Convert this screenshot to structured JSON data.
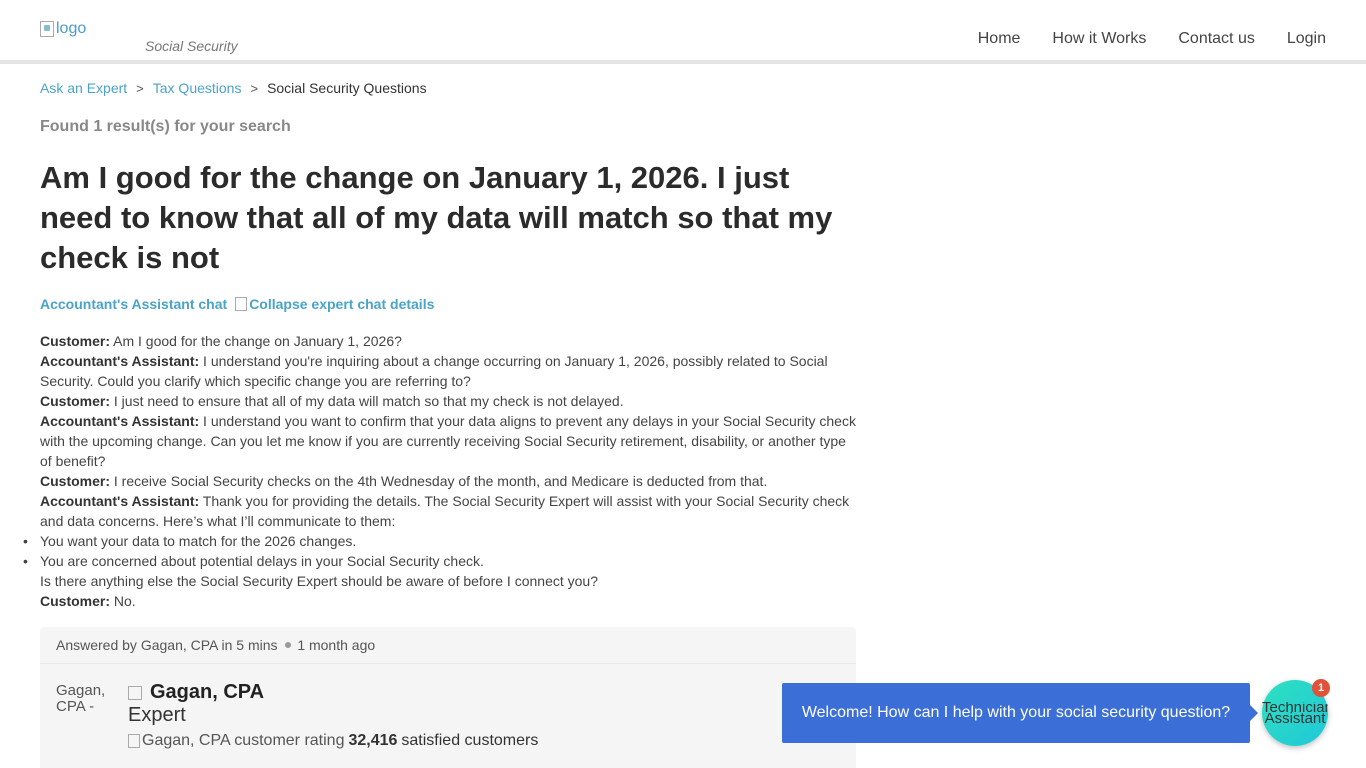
{
  "header": {
    "logo_alt": "logo",
    "logo_subtitle": "Social Security",
    "nav": [
      "Home",
      "How it Works",
      "Contact us",
      "Login"
    ]
  },
  "breadcrumb": {
    "items": [
      "Ask an Expert",
      "Tax Questions"
    ],
    "separator": ">",
    "current": "Social Security Questions"
  },
  "search": {
    "found_text": "Found 1 result(s) for your search"
  },
  "question": {
    "title": "Am I good for the change on January 1, 2026. I just need to know that all of my data will match so that my check is not"
  },
  "chat_toggle": {
    "label": "Accountant's Assistant chat",
    "collapse_alt": "Collapse expert chat details"
  },
  "transcript": [
    {
      "speaker": "Customer:",
      "text": " Am I good for the change on January 1, 2026?"
    },
    {
      "speaker": "Accountant's Assistant:",
      "text": " I understand you're inquiring about a change occurring on January 1, 2026, possibly related to Social Security. Could you clarify which specific change you are referring to?"
    },
    {
      "speaker": "Customer:",
      "text": " I just need to ensure that all of my data will match so that my check is not delayed."
    },
    {
      "speaker": "Accountant's Assistant:",
      "text": " I understand you want to confirm that your data aligns to prevent any delays in your Social Security check with the upcoming change. Can you let me know if you are currently receiving Social Security retirement, disability, or another type of benefit?"
    },
    {
      "speaker": "Customer:",
      "text": " I receive Social Security checks on the 4th Wednesday of the month, and Medicare is deducted from that."
    },
    {
      "speaker": "Accountant's Assistant:",
      "text": " Thank you for providing the details. The Social Security Expert will assist with your Social Security check and data concerns. Here’s what I’ll communicate to them:"
    }
  ],
  "transcript_bullets": [
    "You want your data to match for the 2026 changes.",
    "You are concerned about potential delays in your Social Security check."
  ],
  "transcript_after": "Is there anything else the Social Security Expert should be aware of before I connect you?",
  "transcript_final": {
    "speaker": "Customer:",
    "text": " No."
  },
  "answer": {
    "answered_by": "Answered by Gagan, CPA in 5 mins",
    "time_ago": "1 month ago",
    "avatar_alt": "Gagan, CPA -",
    "expert_name": "Gagan, CPA",
    "expert_role": "Expert",
    "rating_alt": "Gagan, CPA customer rating",
    "satisfied_count": "32,416",
    "satisfied_label": "satisfied customers"
  },
  "chat_widget": {
    "welcome": "Welcome! How can I help with your social security question?",
    "assistant_label": "Technician Assistant",
    "badge_count": "1",
    "colors": {
      "bubble": "#3b6fd7",
      "button": "#2fe0c0",
      "badge": "#e0533a"
    }
  },
  "colors": {
    "link": "#4aa3c8",
    "title": "#2b2b2b"
  }
}
